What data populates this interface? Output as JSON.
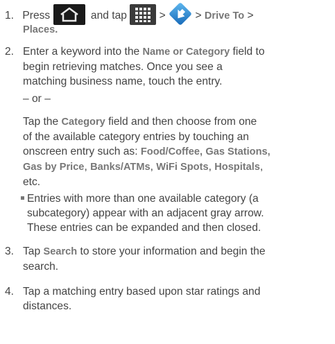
{
  "steps": [
    {
      "num": "1.",
      "press": "Press",
      "and_tap": "and tap",
      "gt1": ">",
      "gt2": "> ",
      "drive_to": "Drive To",
      "gt3": " >",
      "places": "Places."
    },
    {
      "num": "2.",
      "line1_a": "Enter a keyword into the ",
      "name_or_category": "Name or Category",
      "line1_b": " field to",
      "line2": "begin retrieving matches. Once you see a",
      "line3": "matching business name, touch the entry.",
      "or": "– or –",
      "tap": "Tap the ",
      "category": "Category",
      "tap_rest": " field and then choose from one",
      "line5": "of the available category entries by touching an",
      "line6_a": "onscreen entry such as: ",
      "food_coffee": "Food/Coffee,",
      "gas_stations": "Gas Stations,",
      "gas_by_price": "Gas by Price",
      "comma": ", ",
      "banks_atms": "Banks/ATMs",
      "wifi_spots": "WiFi Spots",
      "hospitals": "Hospitals",
      "etc": "etc.",
      "bullet_line1": "Entries with more than one available category (a",
      "bullet_line2": "subcategory) appear with an adjacent gray arrow.",
      "bullet_line3": "These entries can be expanded and then closed."
    },
    {
      "num": "3.",
      "tap": "Tap ",
      "search": "Search",
      "rest": " to store your information and begin the",
      "line2": "search."
    },
    {
      "num": "4.",
      "line1": "Tap a matching entry based upon star ratings and",
      "line2": "distances."
    }
  ],
  "icons": {
    "home": "home-icon",
    "apps": "apps-grid-icon",
    "navigation": "navigation-app-icon"
  }
}
